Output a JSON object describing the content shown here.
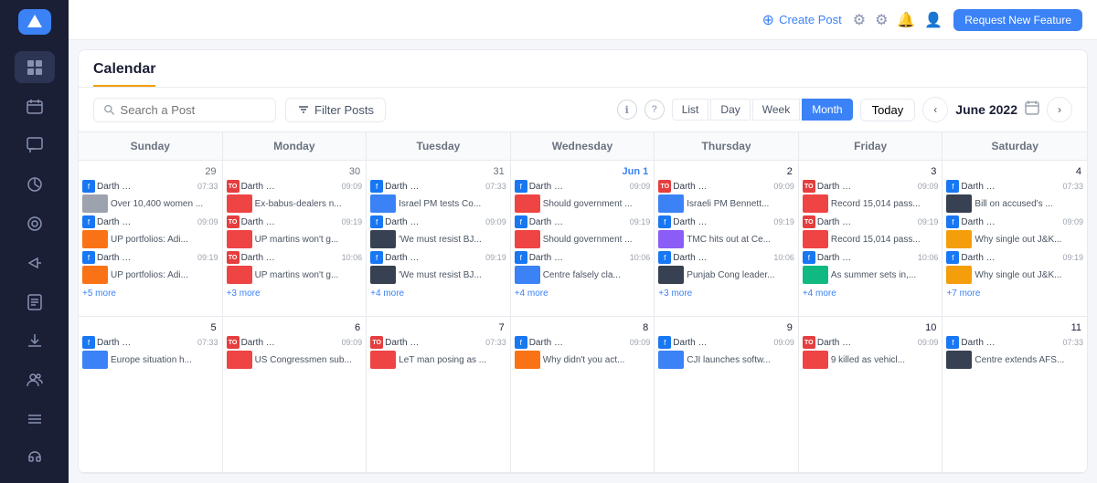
{
  "sidebar": {
    "logo": "◀",
    "items": [
      {
        "name": "dashboard",
        "icon": "⊞",
        "active": false
      },
      {
        "name": "calendar",
        "icon": "▦",
        "active": true
      },
      {
        "name": "messages",
        "icon": "💬",
        "active": false
      },
      {
        "name": "analytics",
        "icon": "✦",
        "active": false
      },
      {
        "name": "alerts",
        "icon": "◎",
        "active": false
      },
      {
        "name": "campaigns",
        "icon": "📢",
        "active": false
      },
      {
        "name": "reports",
        "icon": "📊",
        "active": false
      },
      {
        "name": "downloads",
        "icon": "⬇",
        "active": false
      },
      {
        "name": "team",
        "icon": "👥",
        "active": false
      },
      {
        "name": "feed",
        "icon": "☰",
        "active": false
      },
      {
        "name": "support",
        "icon": "🎧",
        "active": false
      }
    ]
  },
  "topbar": {
    "create_post": "Create Post",
    "request_feature": "Request New Feature"
  },
  "calendar": {
    "title": "Calendar",
    "search_placeholder": "Search a Post",
    "filter_label": "Filter Posts",
    "today_label": "Today",
    "current_month": "June 2022",
    "view_tabs": [
      "List",
      "Day",
      "Week",
      "Month"
    ],
    "active_view": "Month",
    "day_headers": [
      "Sunday",
      "Monday",
      "Tuesday",
      "Wednesday",
      "Thursday",
      "Friday",
      "Saturday"
    ],
    "more_labels": {
      "sun29": "+5 more",
      "mon30": "+3 more",
      "tue31": "+4 more",
      "wed1": "+4 more",
      "thu2": "+3 more",
      "fri3": "+4 more",
      "sat4": "+7 more",
      "sun5": "",
      "mon6": "",
      "tue7": "",
      "wed8": "",
      "thu9": "",
      "fri10": "",
      "sat11": ""
    },
    "week1": [
      {
        "day": "29",
        "is_current": false,
        "posts": [
          {
            "author": "Darth Va...",
            "time": "07:33",
            "title": "Over 10,400 women ...",
            "thumb_color": "thumb-gray",
            "icon_type": "fb"
          },
          {
            "author": "Darth Va...",
            "time": "09:09",
            "title": "UP portfolios: Adi...",
            "thumb_color": "thumb-orange",
            "icon_type": "fb"
          },
          {
            "author": "Darth Va...",
            "time": "09:19",
            "title": "UP portfolios: Adi...",
            "thumb_color": "thumb-orange",
            "icon_type": "fb"
          }
        ],
        "more": "+5 more"
      },
      {
        "day": "30",
        "is_current": false,
        "posts": [
          {
            "author": "Darth Va...",
            "time": "09:09",
            "title": "Ex-babus-dealers n...",
            "thumb_color": "thumb-red",
            "icon_type": "toi"
          },
          {
            "author": "Darth Va...",
            "time": "09:19",
            "title": "UP martins won't g...",
            "thumb_color": "thumb-red",
            "icon_type": "toi"
          },
          {
            "author": "Darth Va...",
            "time": "10:06",
            "title": "UP martins won't g...",
            "thumb_color": "thumb-red",
            "icon_type": "toi"
          }
        ],
        "more": "+3 more"
      },
      {
        "day": "31",
        "is_current": false,
        "posts": [
          {
            "author": "Darth Va...",
            "time": "07:33",
            "title": "Israel PM tests Co...",
            "thumb_color": "thumb-blue",
            "icon_type": "fb"
          },
          {
            "author": "Darth Va...",
            "time": "09:09",
            "title": "'We must resist BJ...",
            "thumb_color": "thumb-dark",
            "icon_type": "fb"
          },
          {
            "author": "Darth Va...",
            "time": "09:19",
            "title": "'We must resist BJ...",
            "thumb_color": "thumb-dark",
            "icon_type": "fb"
          }
        ],
        "more": "+4 more"
      },
      {
        "day": "Jun 1",
        "is_current": true,
        "is_jun1": true,
        "posts": [
          {
            "author": "Darth Va...",
            "time": "09:09",
            "title": "Should government ...",
            "thumb_color": "thumb-red",
            "icon_type": "fb"
          },
          {
            "author": "Darth Va...",
            "time": "09:19",
            "title": "Should government ...",
            "thumb_color": "thumb-red",
            "icon_type": "fb"
          },
          {
            "author": "Darth Va...",
            "time": "10:06",
            "title": "Centre falsely cla...",
            "thumb_color": "thumb-blue",
            "icon_type": "fb"
          }
        ],
        "more": "+4 more"
      },
      {
        "day": "2",
        "is_current": true,
        "posts": [
          {
            "author": "Darth Va...",
            "time": "09:09",
            "title": "Israeli PM Bennett...",
            "thumb_color": "thumb-blue",
            "icon_type": "toi"
          },
          {
            "author": "Darth Va...",
            "time": "09:19",
            "title": "TMC hits out at Ce...",
            "thumb_color": "thumb-purple",
            "icon_type": "fb"
          },
          {
            "author": "Darth Va...",
            "time": "10:06",
            "title": "Punjab Cong leader...",
            "thumb_color": "thumb-dark",
            "icon_type": "fb"
          }
        ],
        "more": "+3 more"
      },
      {
        "day": "3",
        "is_current": true,
        "posts": [
          {
            "author": "Darth Va...",
            "time": "09:09",
            "title": "Record 15,014 pass...",
            "thumb_color": "thumb-red",
            "icon_type": "toi"
          },
          {
            "author": "Darth Va...",
            "time": "09:19",
            "title": "Record 15,014 pass...",
            "thumb_color": "thumb-red",
            "icon_type": "toi"
          },
          {
            "author": "Darth Va...",
            "time": "10:06",
            "title": "As summer sets in,...",
            "thumb_color": "thumb-green",
            "icon_type": "fb"
          }
        ],
        "more": "+4 more"
      },
      {
        "day": "4",
        "is_current": true,
        "posts": [
          {
            "author": "Darth Va...",
            "time": "07:33",
            "title": "Bill on accused's ...",
            "thumb_color": "thumb-dark",
            "icon_type": "fb"
          },
          {
            "author": "Darth Va...",
            "time": "09:09",
            "title": "Why single out J&K...",
            "thumb_color": "thumb-yellow",
            "icon_type": "fb"
          },
          {
            "author": "Darth Va...",
            "time": "09:19",
            "title": "Why single out J&K...",
            "thumb_color": "thumb-yellow",
            "icon_type": "fb"
          }
        ],
        "more": "+7 more"
      }
    ],
    "week2": [
      {
        "day": "5",
        "is_current": true,
        "posts": [
          {
            "author": "Darth Va...",
            "time": "07:33",
            "title": "Europe situation h...",
            "thumb_color": "thumb-blue",
            "icon_type": "fb"
          }
        ],
        "more": ""
      },
      {
        "day": "6",
        "is_current": true,
        "posts": [
          {
            "author": "Darth Va...",
            "time": "09:09",
            "title": "US Congressmen sub...",
            "thumb_color": "thumb-red",
            "icon_type": "toi"
          }
        ],
        "more": ""
      },
      {
        "day": "7",
        "is_current": true,
        "posts": [
          {
            "author": "Darth Va...",
            "time": "07:33",
            "title": "LeT man posing as ...",
            "thumb_color": "thumb-red",
            "icon_type": "toi"
          }
        ],
        "more": ""
      },
      {
        "day": "8",
        "is_current": true,
        "posts": [
          {
            "author": "Darth Va...",
            "time": "09:09",
            "title": "Why didn't you act...",
            "thumb_color": "thumb-orange",
            "icon_type": "fb"
          }
        ],
        "more": ""
      },
      {
        "day": "9",
        "is_current": true,
        "posts": [
          {
            "author": "Darth Va...",
            "time": "09:09",
            "title": "CJI launches softw...",
            "thumb_color": "thumb-blue",
            "icon_type": "fb"
          }
        ],
        "more": ""
      },
      {
        "day": "10",
        "is_current": true,
        "posts": [
          {
            "author": "Darth Va...",
            "time": "09:09",
            "title": "9 killed as vehicl...",
            "thumb_color": "thumb-red",
            "icon_type": "toi"
          }
        ],
        "more": ""
      },
      {
        "day": "11",
        "is_current": true,
        "posts": [
          {
            "author": "Darth Va...",
            "time": "07:33",
            "title": "Centre extends AFS...",
            "thumb_color": "thumb-dark",
            "icon_type": "fb"
          }
        ],
        "more": ""
      }
    ]
  }
}
